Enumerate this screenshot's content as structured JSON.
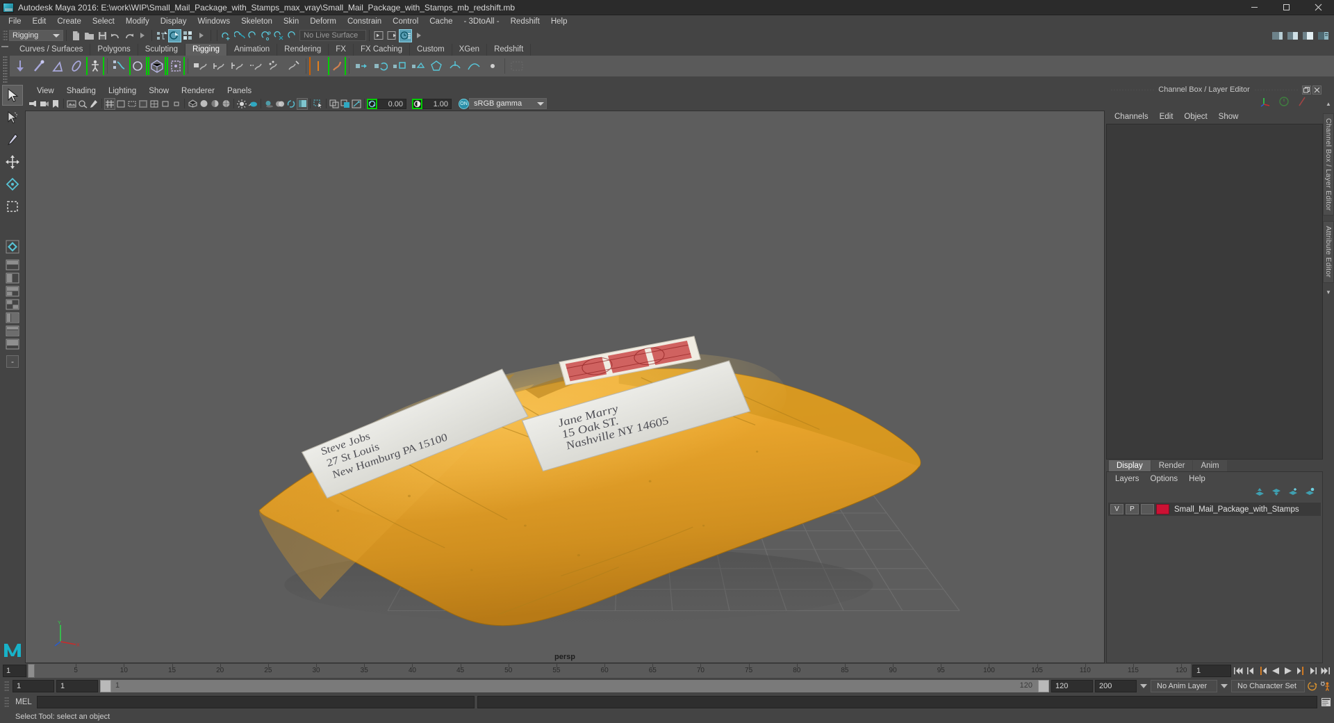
{
  "window": {
    "title": "Autodesk Maya 2016: E:\\work\\WIP\\Small_Mail_Package_with_Stamps_max_vray\\Small_Mail_Package_with_Stamps_mb_redshift.mb",
    "minimize": "–",
    "maximize": "□",
    "close": "✕"
  },
  "menubar": {
    "items": [
      "File",
      "Edit",
      "Create",
      "Select",
      "Modify",
      "Display",
      "Windows",
      "Skeleton",
      "Skin",
      "Deform",
      "Constrain",
      "Control",
      "Cache",
      "- 3DtoAll -",
      "Redshift",
      "Help"
    ]
  },
  "statusbar": {
    "menu_set": "Rigging",
    "live_surface": "No Live Surface"
  },
  "shelf": {
    "tabs": [
      "Curves / Surfaces",
      "Polygons",
      "Sculpting",
      "Rigging",
      "Animation",
      "Rendering",
      "FX",
      "FX Caching",
      "Custom",
      "XGen",
      "Redshift"
    ],
    "active_tab": "Rigging"
  },
  "viewport": {
    "menus": [
      "View",
      "Shading",
      "Lighting",
      "Show",
      "Renderer",
      "Panels"
    ],
    "exposure": "0.00",
    "gamma_value": "1.00",
    "color_management": "sRGB gamma",
    "camera_label": "persp",
    "axis_labels": {
      "y": "Y",
      "x": "X",
      "z": "Z"
    }
  },
  "channel_box": {
    "panel_title": "Channel Box / Layer Editor",
    "menus": [
      "Channels",
      "Edit",
      "Object",
      "Show"
    ]
  },
  "layer_editor": {
    "tabs": [
      "Display",
      "Render",
      "Anim"
    ],
    "active_tab": "Display",
    "menus": [
      "Layers",
      "Options",
      "Help"
    ],
    "layers": [
      {
        "visibility": "V",
        "playback": "P",
        "color": "#cc1133",
        "name": "Small_Mail_Package_with_Stamps"
      }
    ]
  },
  "right_vertical_tabs": [
    "Channel Box / Layer Editor",
    "Attribute Editor"
  ],
  "timeline": {
    "current_frame_left": "1",
    "current_frame_field": "1",
    "ticks": [
      5,
      10,
      15,
      20,
      25,
      30,
      35,
      40,
      45,
      50,
      55,
      60,
      65,
      70,
      75,
      80,
      85,
      90,
      95,
      100,
      105,
      110,
      115,
      120
    ],
    "end_label": "120",
    "playback_buttons": [
      "go-to-start",
      "step-back-key",
      "step-back-frame",
      "play-backwards",
      "play-forwards",
      "step-forward-frame",
      "step-forward-key",
      "go-to-end"
    ]
  },
  "range_slider": {
    "anim_start": "1",
    "range_start": "1",
    "slider_label": "1",
    "slider_end_label": "120",
    "range_end": "120",
    "anim_end": "200",
    "anim_layer": "No Anim Layer",
    "character_set": "No Character Set"
  },
  "command_line": {
    "label": "MEL",
    "input_value": "",
    "output_value": ""
  },
  "status_line": {
    "text": "Select Tool: select an object"
  },
  "colors": {
    "accent_teal": "#2b8fa8",
    "shelf_green": "#00d000",
    "layer_red": "#cc1133",
    "playhead_orange": "#e08020",
    "viewport_bg": "#5d5d5d",
    "envelope": "#e2a42a"
  }
}
